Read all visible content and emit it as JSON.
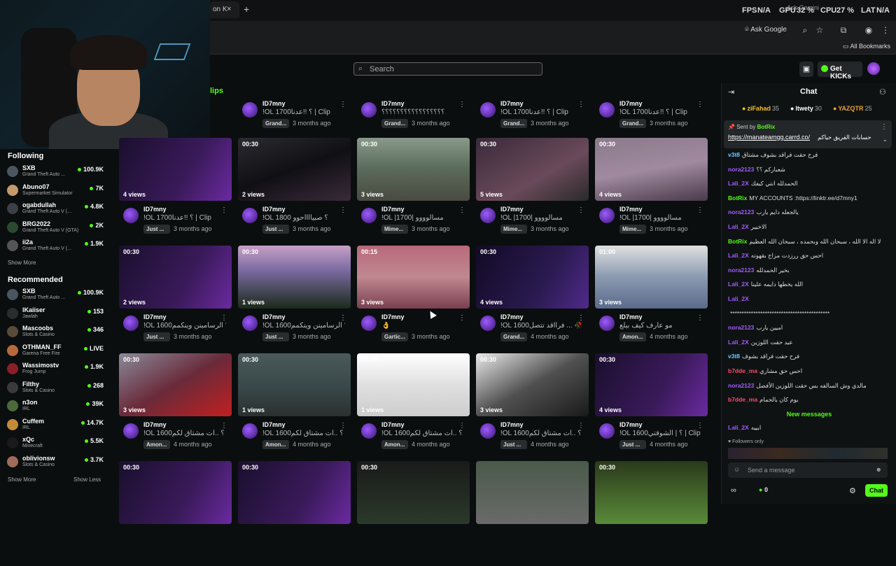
{
  "browser": {
    "tab_partial": "on K",
    "new_tab": "+",
    "close": "×",
    "ask_google": "Ask Google",
    "bookmarks": "All Bookmarks",
    "tooltip": "Ask Gemini"
  },
  "perf": {
    "fps_label": "FPS",
    "fps": "N/A",
    "gpu_label": "GPU",
    "gpu": "32 %",
    "cpu_label": "CPU",
    "cpu": "27 %",
    "lat_label": "LAT",
    "lat": "N/A"
  },
  "header": {
    "search_placeholder": "Search",
    "get_kicks": "Get KICKs",
    "clips_tab": "lips"
  },
  "sidebar": {
    "following_heading": "Following",
    "following": [
      {
        "name": "SXB",
        "category": "Grand Theft Auto ...",
        "viewers": "100.9K"
      },
      {
        "name": "Abuno07",
        "category": "Supermarket Simulator",
        "viewers": "7K"
      },
      {
        "name": "ogabdullah",
        "category": "Grand Theft Auto V (...",
        "viewers": "4.8K"
      },
      {
        "name": "BRG2022",
        "category": "Grand Theft Auto V (GTA)",
        "viewers": "2K"
      },
      {
        "name": "ii2a",
        "category": "Grand Theft Auto V (...",
        "viewers": "1.9K"
      }
    ],
    "show_more_1": "Show More",
    "recommended_heading": "Recommended",
    "recommended": [
      {
        "name": "SXB",
        "category": "Grand Theft Auto ...",
        "viewers": "100.9K"
      },
      {
        "name": "lKaiiser",
        "category": "Jawlah",
        "viewers": "153"
      },
      {
        "name": "Mascoobs",
        "category": "Slots & Casino",
        "viewers": "346"
      },
      {
        "name": "OTHMAN_FF",
        "category": "Garena Free Fire",
        "viewers": "LIVE"
      },
      {
        "name": "Wassimostv",
        "category": "Frog Jump",
        "viewers": "1.9K"
      },
      {
        "name": "Filthy",
        "category": "Slots & Casino",
        "viewers": "268"
      },
      {
        "name": "n3on",
        "category": "IRL",
        "viewers": "39K"
      },
      {
        "name": "Cuffem",
        "category": "IRL",
        "viewers": "14.7K"
      },
      {
        "name": "xQc",
        "category": "Minecraft",
        "viewers": "5.5K"
      },
      {
        "name": "oblivionsw",
        "category": "Slots & Casino",
        "viewers": "3.7K"
      }
    ],
    "show_more_2": "Show More",
    "show_less": "Show Less"
  },
  "top_row": [
    {
      "name": "ID7mny",
      "title": "!OL 1700؟ !!عدنا | Clip",
      "badge": "Grand...",
      "ago": "3 months ago"
    },
    {
      "name": "ID7mny",
      "title": "؟؟؟؟؟؟؟؟؟؟؟؟؟؟؟؟؟",
      "badge": "Grand...",
      "ago": "3 months ago"
    },
    {
      "name": "ID7mny",
      "title": "!OL 1700؟ !!عدنا | Clip",
      "badge": "Grand...",
      "ago": "3 months ago"
    },
    {
      "name": "ID7mny",
      "title": "!OL 1700؟ !!عدنا | Clip",
      "badge": "Grand...",
      "ago": "3 months ago"
    }
  ],
  "clips": [
    {
      "dur": "",
      "views": "4 views",
      "name": "ID7mny",
      "title": "!OL 1700؟ !!عدنا | Clip",
      "badge": "Just ...",
      "ago": "3 months ago"
    },
    {
      "dur": "00:30",
      "views": "2 views",
      "name": "ID7mny",
      "title": "!OL 1800 ؟ صبيااااحوو",
      "badge": "Just ...",
      "ago": "3 months ago"
    },
    {
      "dur": "00:30",
      "views": "3 views",
      "name": "ID7mny",
      "title": "!OL |1700| مسالوووو",
      "badge": "Mime...",
      "ago": "3 months ago"
    },
    {
      "dur": "00:30",
      "views": "5 views",
      "name": "ID7mny",
      "title": "!OL |1700| مسالوووو",
      "badge": "Mime...",
      "ago": "3 months ago"
    },
    {
      "dur": "00:30",
      "views": "4 views",
      "name": "ID7mny",
      "title": "!OL |1700| مسالوووو",
      "badge": "Mime...",
      "ago": "3 months ago"
    },
    {
      "dur": "00:30",
      "views": "2 views",
      "name": "ID7mny",
      "title": "!OL 1600؟ الرسامينن وينكمم",
      "badge": "Just ...",
      "ago": "3 months ago"
    },
    {
      "dur": "00:30",
      "views": "1 views",
      "name": "ID7mny",
      "title": "!OL 1600؟ الرسامينن وينكمم",
      "badge": "Just ...",
      "ago": "3 months ago"
    },
    {
      "dur": "00:15",
      "views": "3 views",
      "name": "ID7mny",
      "title": "👌",
      "badge": "Gartic...",
      "ago": "3 months ago"
    },
    {
      "dur": "00:30",
      "views": "4 views",
      "name": "ID7mny",
      "title": "!OL 1600؟ | 🥀 ... فرااقد تتصل",
      "badge": "Grand...",
      "ago": "4 months ago"
    },
    {
      "dur": "01:00",
      "views": "3 views",
      "name": "ID7mny",
      "title": "مو عارف كيف بيلع",
      "badge": "Amon...",
      "ago": "4 months ago"
    },
    {
      "dur": "00:30",
      "views": "3 views",
      "name": "ID7mny",
      "title": "!OL 1600؟ ..ات مشتاق لكم",
      "badge": "Amon...",
      "ago": "4 months ago"
    },
    {
      "dur": "00:30",
      "views": "1 views",
      "name": "ID7mny",
      "title": "!OL 1600؟ ..ات مشتاق لكم",
      "badge": "Amon...",
      "ago": "4 months ago"
    },
    {
      "dur": "00:30",
      "views": "1 views",
      "name": "ID7mny",
      "title": "!OL 1600؟ ..ات مشتاق لكم",
      "badge": "Amon...",
      "ago": "4 months ago"
    },
    {
      "dur": "00:30",
      "views": "3 views",
      "name": "ID7mny",
      "title": "!OL 1600؟ ..ات مشتاق لكم",
      "badge": "Just ...",
      "ago": "4 months ago"
    },
    {
      "dur": "00:30",
      "views": "4 views",
      "name": "ID7mny",
      "title": "!OL 1600؟ | الشوقتي | Clip",
      "badge": "Just ...",
      "ago": "4 months ago"
    },
    {
      "dur": "00:30",
      "views": "",
      "name": "",
      "title": "",
      "badge": "",
      "ago": ""
    },
    {
      "dur": "00:30",
      "views": "",
      "name": "",
      "title": "",
      "badge": "",
      "ago": ""
    },
    {
      "dur": "00:30",
      "views": "",
      "name": "",
      "title": "",
      "badge": "",
      "ago": ""
    },
    {
      "dur": "",
      "views": "",
      "name": "",
      "title": "",
      "badge": "",
      "ago": ""
    },
    {
      "dur": "00:30",
      "views": "",
      "name": "",
      "title": "",
      "badge": "",
      "ago": ""
    }
  ],
  "chat": {
    "title": "Chat",
    "gifters": [
      {
        "name": "ziFahad",
        "n": "35"
      },
      {
        "name": "ltwety",
        "n": "30"
      },
      {
        "name": "YAZQTR",
        "n": "25"
      }
    ],
    "pinned": {
      "sent_by_label": "Sent by",
      "sent_by": "BotRix",
      "link": "https://manateamgg.carrd.co/",
      "text": "حسابات الفريق حياكم"
    },
    "messages": [
      {
        "user": "v3t8",
        "color": "#6cf",
        "text": "فرح حقت فراقد بشوف مشتاق"
      },
      {
        "user": "nora2123",
        "color": "#a05cff",
        "text": "شعباركم ؟؟"
      },
      {
        "user": "Lali_2X",
        "color": "#a05cff",
        "text": "الحمدلله انتي كيفك"
      },
      {
        "user": "BotRix",
        "color": "#53fc18",
        "text": "MY ACCOUNTS :https://linktr.ee/d7mny1"
      },
      {
        "user": "nora2123",
        "color": "#a05cff",
        "text": "يالجعله دايم يارب"
      },
      {
        "user": "Lali_2X",
        "color": "#a05cff",
        "text": "الاخيير"
      },
      {
        "user": "BotRix",
        "color": "#53fc18",
        "text": "لا اله الا الله ، سبحان الله وبحمده ، سبحان الله العظيم"
      },
      {
        "user": "Lali_2X",
        "color": "#a05cff",
        "text": "احس حق ررزدت مزاج بقهوته"
      },
      {
        "user": "nora2123",
        "color": "#a05cff",
        "text": "بخير الحمدلله"
      },
      {
        "user": "Lali_2X",
        "color": "#a05cff",
        "text": "الله يخطها دايمه علينا"
      },
      {
        "user": "Lali_2X",
        "color": "#a05cff",
        "text": ""
      },
      {
        "user": "",
        "color": "#ddd",
        "text": "*******************************************"
      },
      {
        "user": "nora2123",
        "color": "#a05cff",
        "text": "اميين يارب"
      },
      {
        "user": "Lali_2X",
        "color": "#a05cff",
        "text": "عيد حقت اللوزين"
      },
      {
        "user": "v3t8",
        "color": "#6cf",
        "text": "فرح حقت فراقد بشوف"
      },
      {
        "user": "b7dde_ma",
        "color": "#ff4d6d",
        "text": "احس حق مشاري"
      },
      {
        "user": "nora2123",
        "color": "#a05cff",
        "text": "مالدي وش السالفه بس حقت اللوزين الأفضل"
      },
      {
        "user": "b7dde_ma",
        "color": "#ff4d6d",
        "text": "يوم كان بالحمام"
      }
    ],
    "new_messages": "New messages",
    "last": {
      "user": "Lali_2X",
      "text": "ابييه"
    },
    "followers_only": "Followers only",
    "input_placeholder": "Send a message",
    "kick_count": "0",
    "send": "Chat"
  }
}
